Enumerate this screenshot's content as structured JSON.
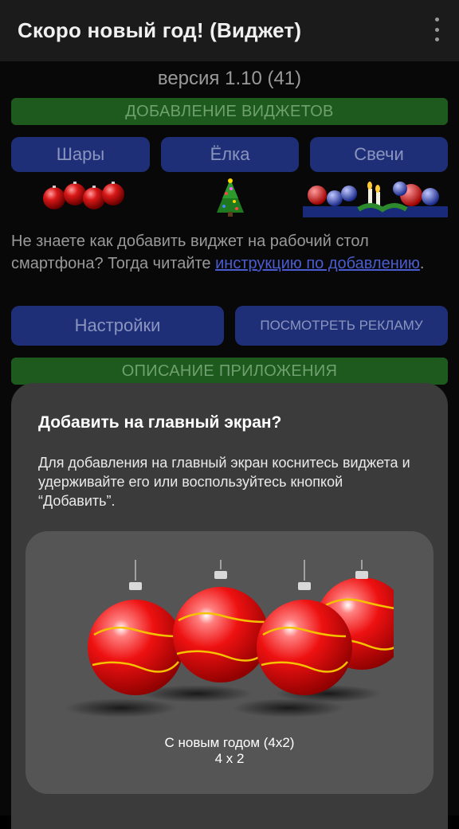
{
  "app_bar": {
    "title": "Скоро новый год! (Виджет)",
    "menu_icon": "more-vert-icon"
  },
  "version": "версия 1.10 (41)",
  "sections": {
    "add_widgets": "ДОБАВЛЕНИЕ ВИДЖЕТОВ",
    "description": "ОПИСАНИЕ ПРИЛОЖЕНИЯ"
  },
  "widgets": [
    {
      "label": "Шары"
    },
    {
      "label": "Ёлка"
    },
    {
      "label": "Свечи"
    }
  ],
  "info": {
    "text_before": "Не знаете как добавить виджет на рабочий стол смартфона? Тогда читайте ",
    "link": "инструкцию по добавлению",
    "text_after": "."
  },
  "buttons": {
    "settings": "Настройки",
    "watch_ad": "ПОСМОТРЕТЬ РЕКЛАМУ"
  },
  "dialog": {
    "title": "Добавить на главный экран?",
    "body": "Для добавления на главный экран коснитесь виджета и удерживайте его или воспользуйтесь кнопкой “Добавить”.",
    "widget_name": "С новым годом (4x2)",
    "widget_size": "4 x 2"
  },
  "colors": {
    "section_bar": "#1e5a1e",
    "button": "#1e2f78",
    "sheet": "#3b3b3b",
    "card": "#555555"
  }
}
